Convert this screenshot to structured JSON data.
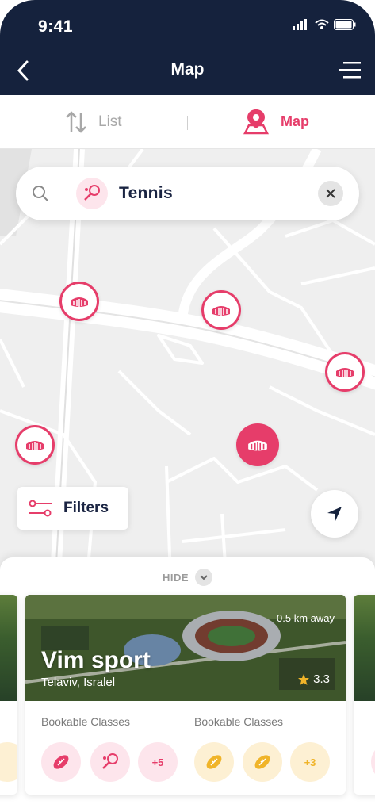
{
  "status": {
    "time": "9:41"
  },
  "header": {
    "title": "Map"
  },
  "toggle": {
    "list_label": "List",
    "map_label": "Map"
  },
  "search": {
    "query": "Tennis"
  },
  "map": {
    "filters_label": "Filters"
  },
  "sheet": {
    "hide_label": "HIDE",
    "card": {
      "distance": "0.5 km away",
      "name": "Vim sport",
      "location": "Telaviv, Isralel",
      "rating": "3.3",
      "left_label": "Bookable Classes",
      "right_label": "Bookable Classes",
      "left_more": "+5",
      "right_more": "+3"
    }
  },
  "colors": {
    "primary": "#15223d",
    "accent": "#e63d6a",
    "accent_light": "#fde5ec",
    "gold": "#f0b429",
    "gold_light": "#fdf0d3"
  }
}
